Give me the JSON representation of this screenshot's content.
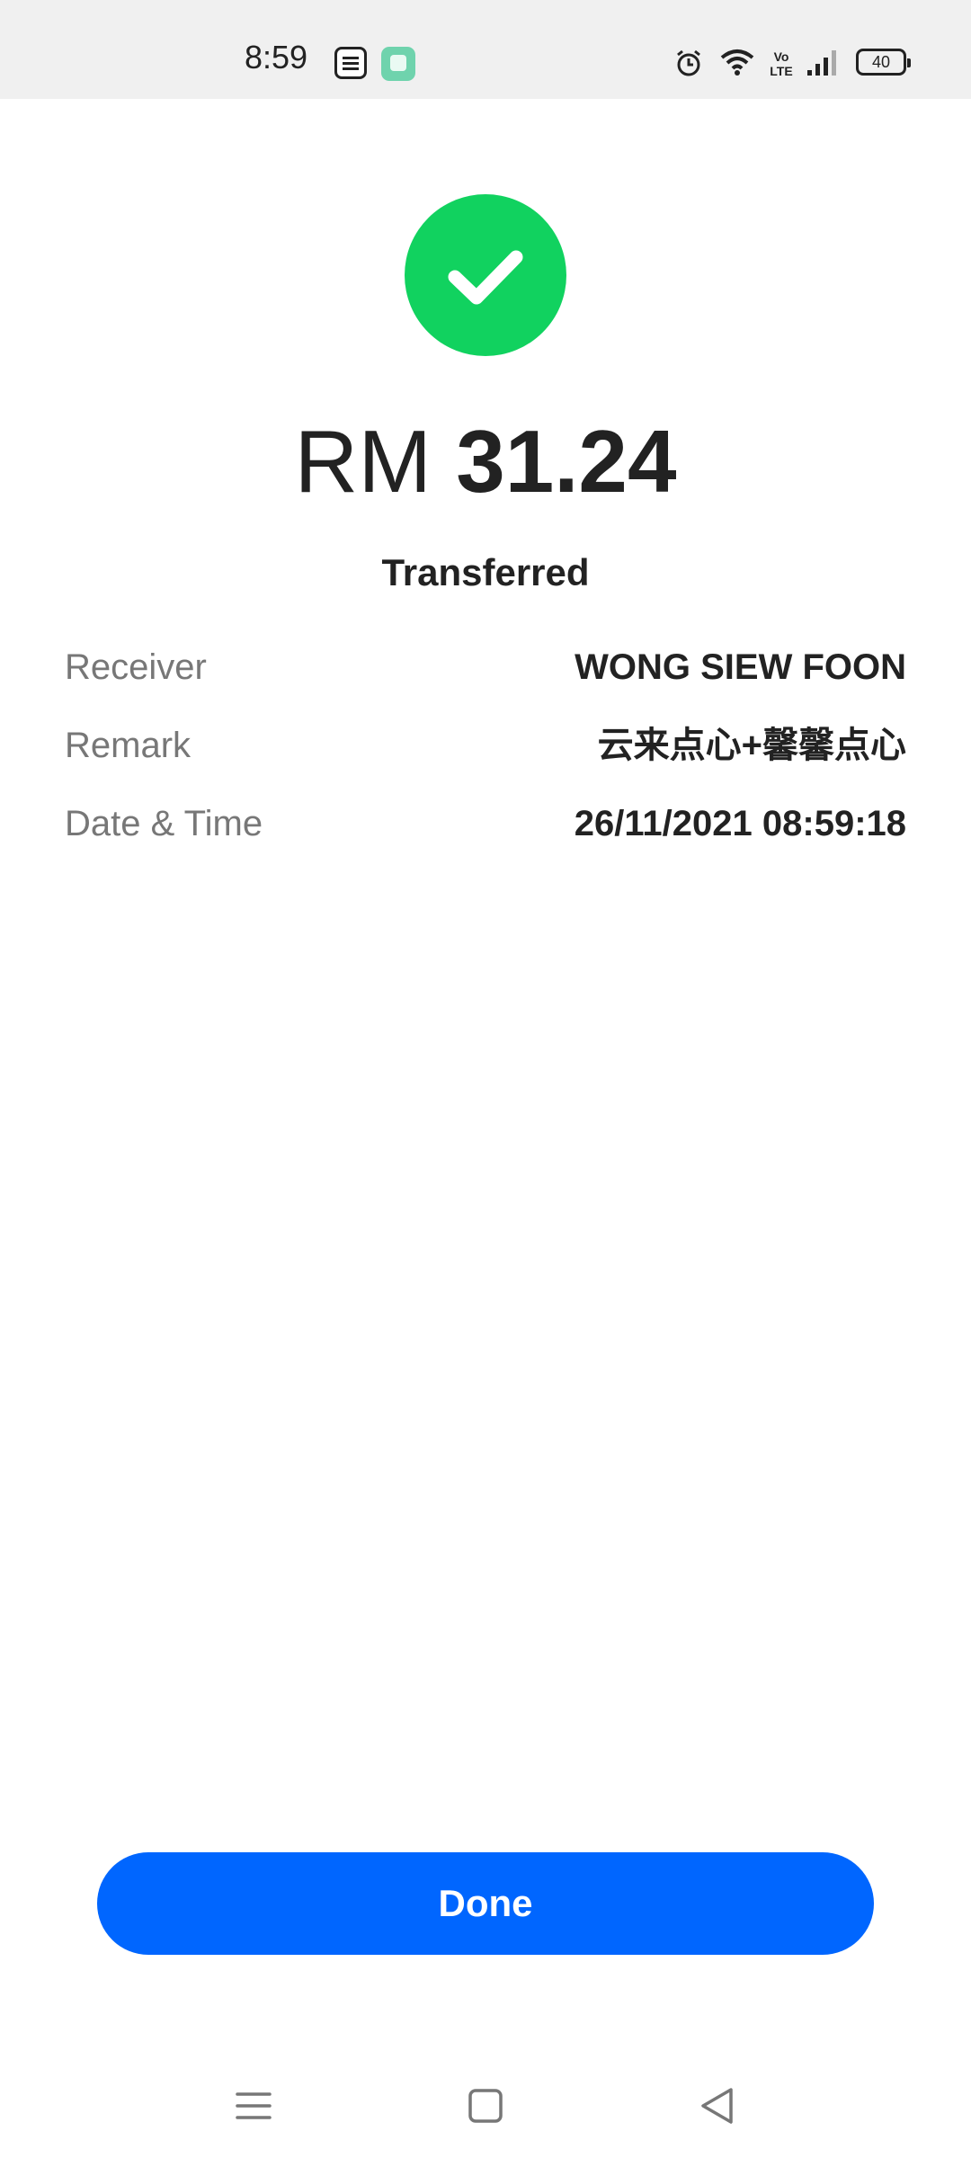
{
  "status_bar": {
    "time": "8:59",
    "volte_label": "Vo\nLTE",
    "battery": "40",
    "icons": [
      "tng-ewallet-icon",
      "app-icon",
      "alarm-icon",
      "wifi-icon",
      "volte-icon",
      "signal-icon",
      "battery-icon"
    ]
  },
  "result": {
    "icon": "check-icon",
    "icon_color": "#11d25f",
    "currency": "RM",
    "amount": "31.24",
    "status": "Transferred"
  },
  "details": [
    {
      "label": "Receiver",
      "value": "WONG SIEW FOON"
    },
    {
      "label": "Remark",
      "value": "云来点心+馨馨点心"
    },
    {
      "label": "Date & Time",
      "value": "26/11/2021 08:59:18"
    }
  ],
  "actions": {
    "done_label": "Done",
    "done_color": "#0066ff"
  },
  "nav_bar": {
    "icons": [
      "menu-icon",
      "home-icon",
      "back-icon"
    ]
  }
}
